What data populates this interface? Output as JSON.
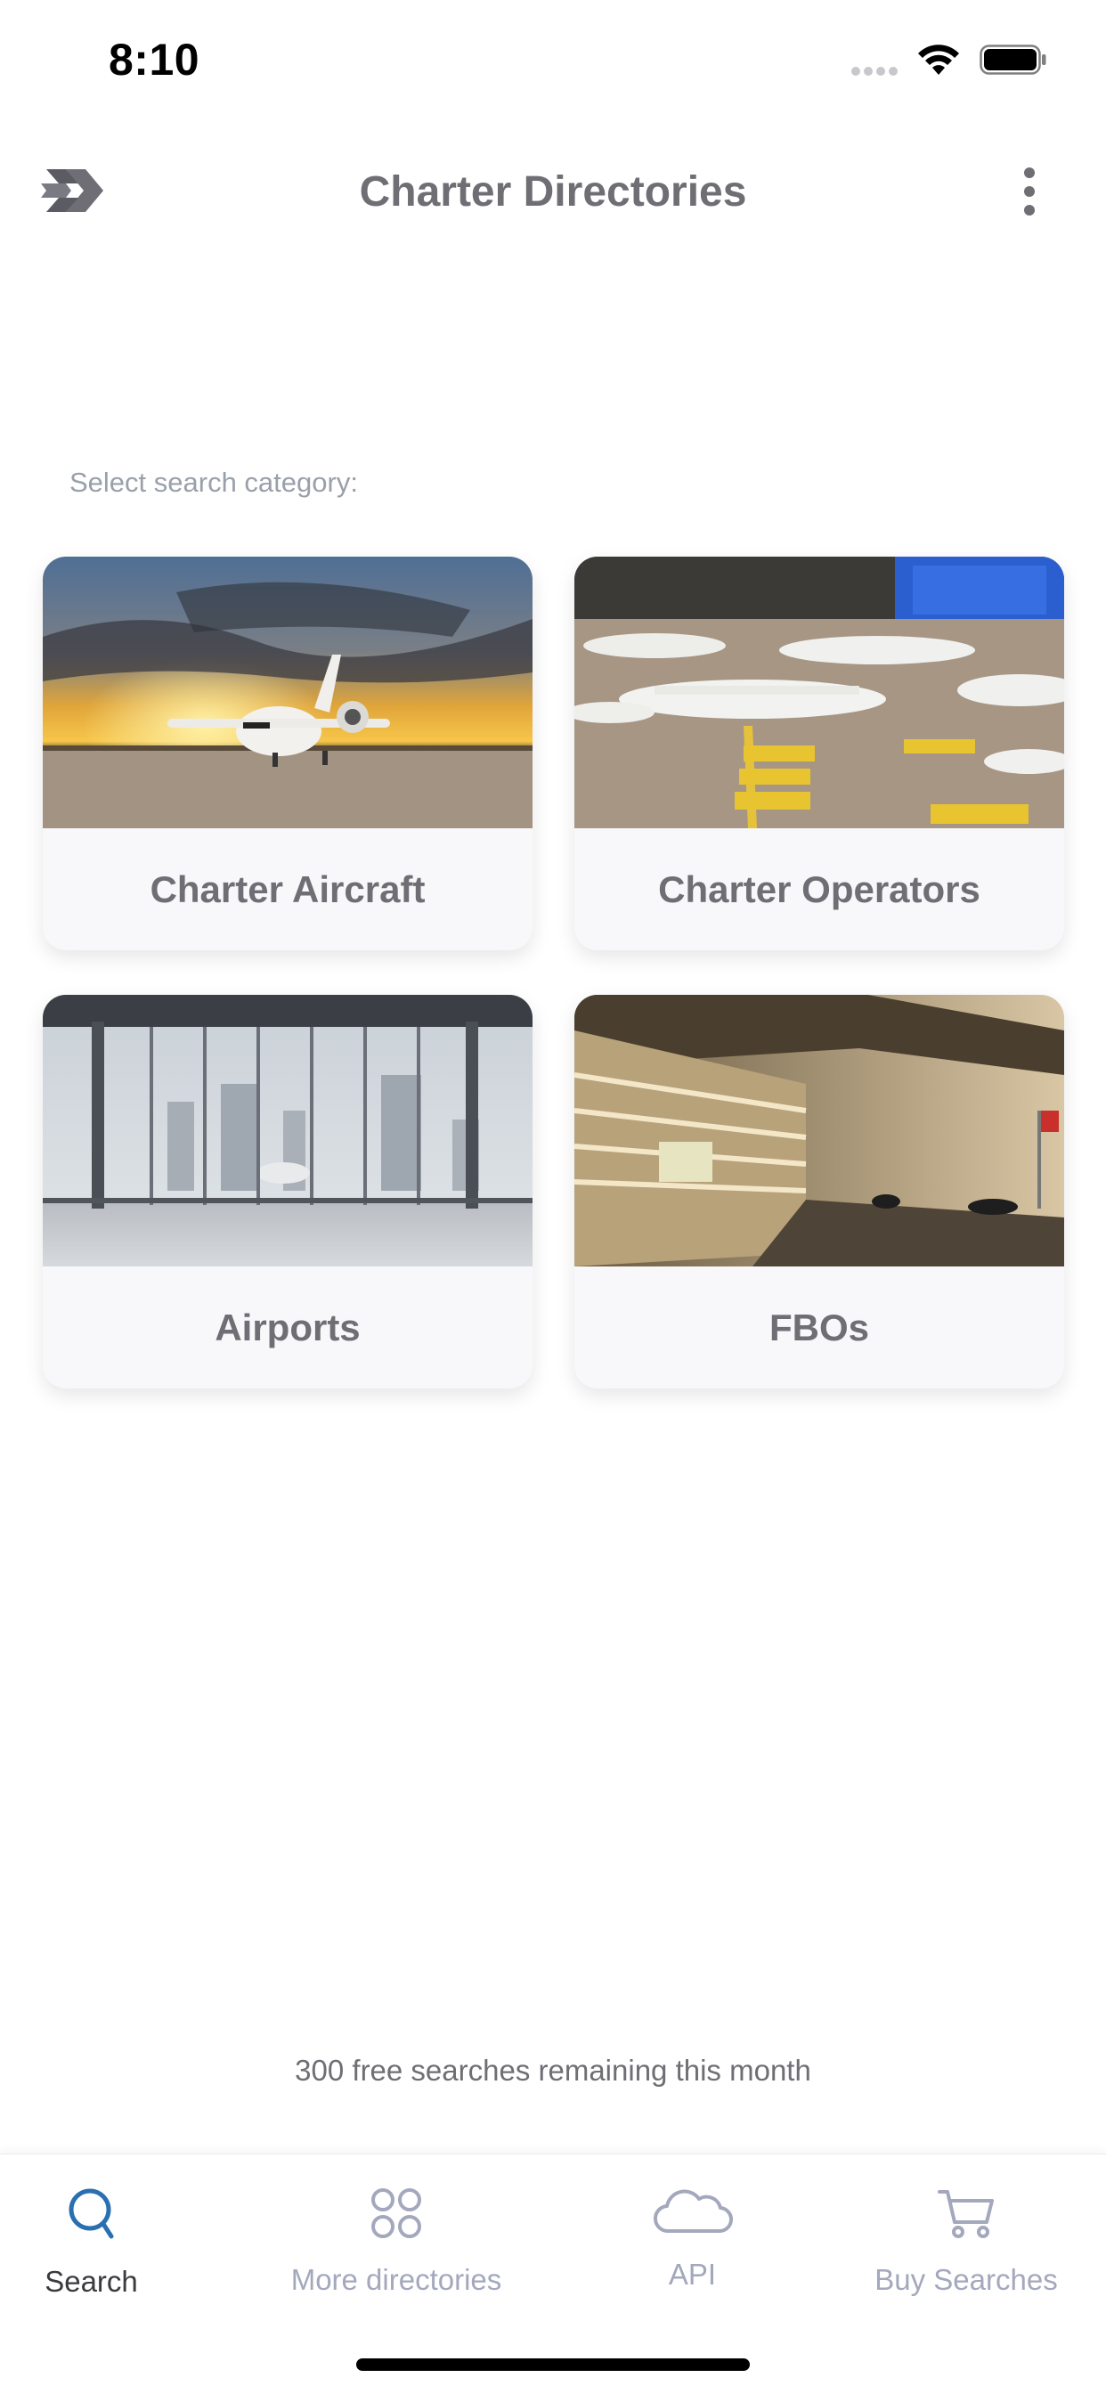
{
  "status_bar": {
    "time": "8:10"
  },
  "header": {
    "title": "Charter Directories",
    "logo_icon": "jet-logo-icon",
    "menu_icon": "more-vertical-icon"
  },
  "section_label": "Select search category:",
  "categories": [
    {
      "label": "Charter Aircraft",
      "image": "jet-at-sunset-photo"
    },
    {
      "label": "Charter Operators",
      "image": "jets-on-apron-photo"
    },
    {
      "label": "Airports",
      "image": "airport-terminal-window-photo"
    },
    {
      "label": "FBOs",
      "image": "fbo-building-night-photo"
    }
  ],
  "footer_text": "300 free searches remaining this month",
  "tabs": [
    {
      "label": "Search",
      "icon": "search-icon",
      "active": true
    },
    {
      "label": "More directories",
      "icon": "grid-icon",
      "active": false
    },
    {
      "label": "API",
      "icon": "cloud-icon",
      "active": false
    },
    {
      "label": "Buy Searches",
      "icon": "cart-icon",
      "active": false
    }
  ],
  "colors": {
    "active_tab_icon": "#2a6fb0",
    "inactive_tab": "#a3a8bd",
    "title": "#6e6e74"
  }
}
